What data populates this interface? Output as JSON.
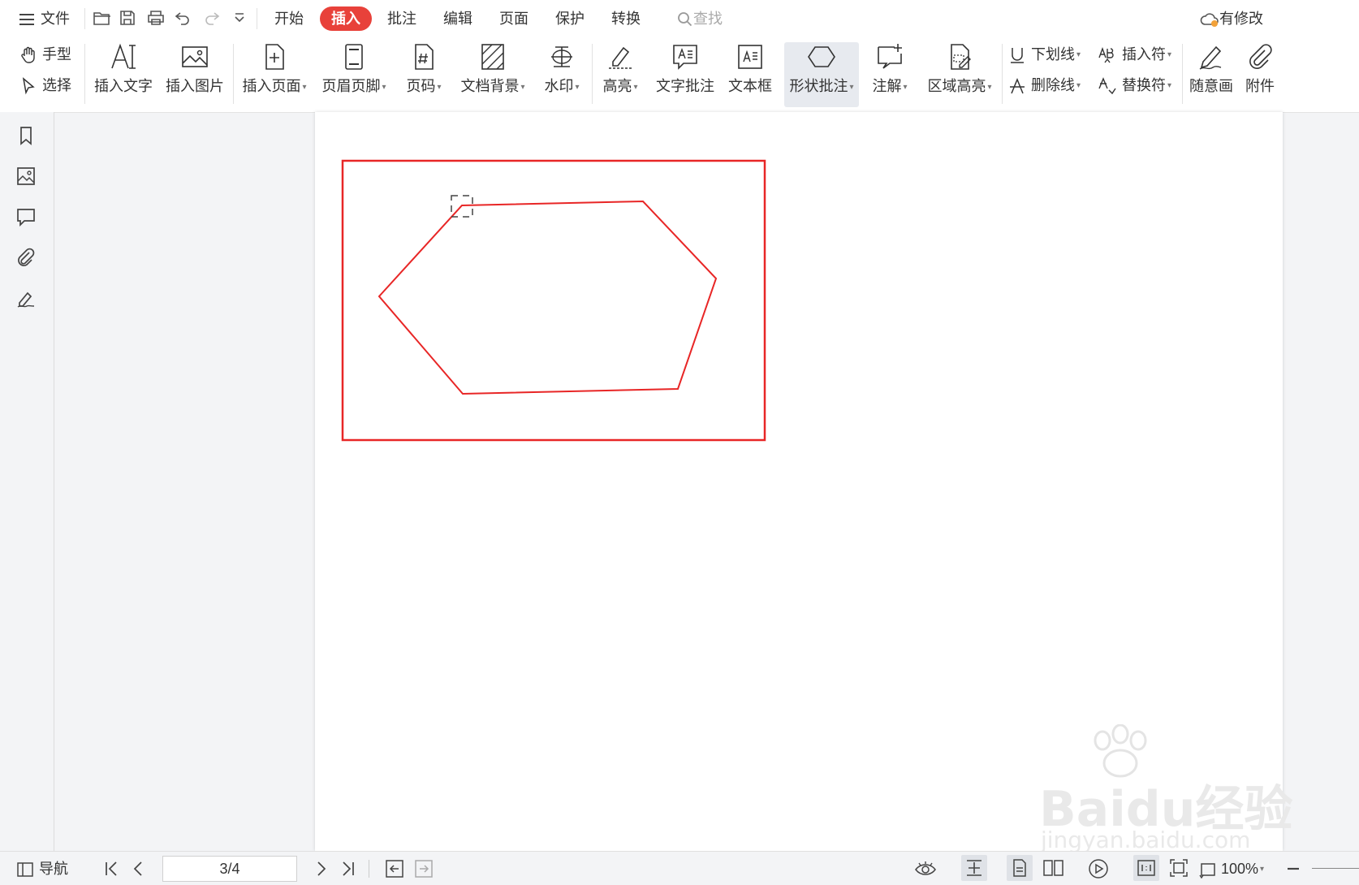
{
  "menu": {
    "file_label": "文件",
    "search_placeholder": "查找",
    "cloud_status": "有修改"
  },
  "tabs": [
    {
      "label": "开始",
      "active": false
    },
    {
      "label": "插入",
      "active": true
    },
    {
      "label": "批注",
      "active": false
    },
    {
      "label": "编辑",
      "active": false
    },
    {
      "label": "页面",
      "active": false
    },
    {
      "label": "保护",
      "active": false
    },
    {
      "label": "转换",
      "active": false
    }
  ],
  "ribbon": {
    "hand": "手型",
    "select": "选择",
    "insert_text": "插入文字",
    "insert_image": "插入图片",
    "insert_page": "插入页面",
    "header_footer": "页眉页脚",
    "page_number": "页码",
    "doc_background": "文档背景",
    "watermark": "水印",
    "highlight": "高亮",
    "text_comment": "文字批注",
    "text_box": "文本框",
    "shape_comment": "形状批注",
    "annotation": "注解",
    "area_highlight": "区域高亮",
    "underline": "下划线",
    "strikethrough": "删除线",
    "insert_symbol": "插入符",
    "replace_symbol": "替换符",
    "freehand": "随意画",
    "attachment": "附件"
  },
  "status": {
    "nav": "导航",
    "page": "3/4",
    "zoom": "100%"
  },
  "colors": {
    "accent": "#e8413a",
    "annotation": "#e82626"
  },
  "watermark": {
    "brand": "Baidu经验",
    "url": "jingyan.baidu.com"
  }
}
